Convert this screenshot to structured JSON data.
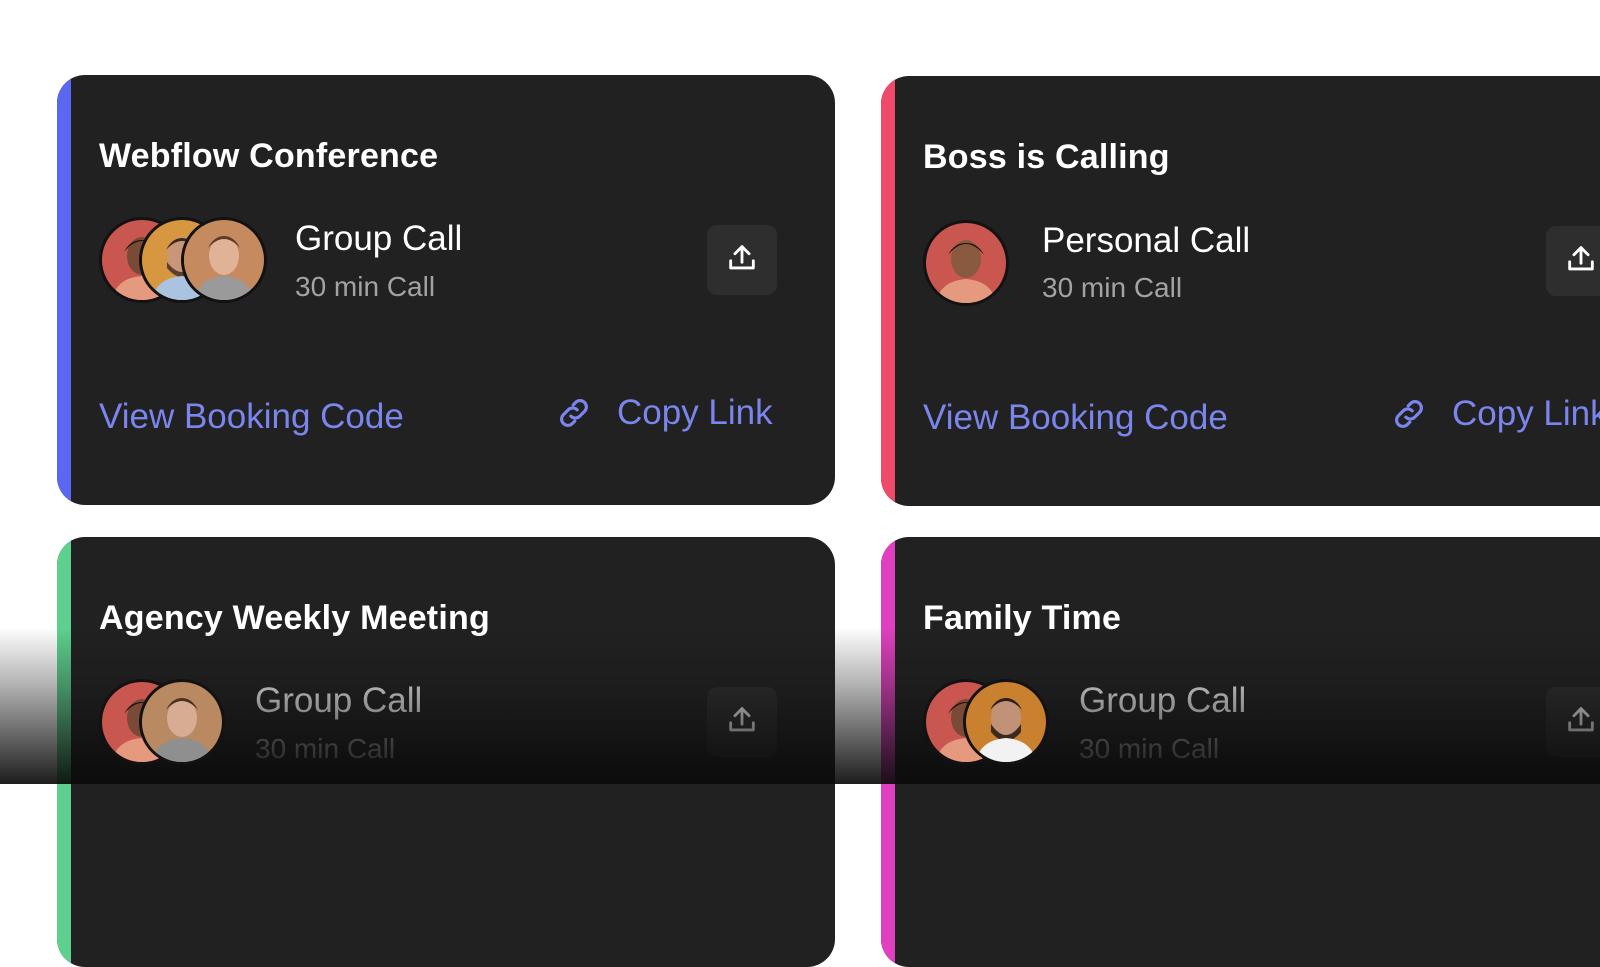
{
  "colors": {
    "card_bg": "#212121",
    "link": "#7b85ee",
    "accent_blue": "#5b67f0",
    "accent_red": "#f04a6a",
    "accent_green": "#5ed08e",
    "accent_pink": "#e040c0"
  },
  "cards": [
    {
      "title": "Webflow Conference",
      "call_type": "Group Call",
      "duration": "30 min Call",
      "view_label": "View Booking Code",
      "copy_label": "Copy Link",
      "avatar_count": 3
    },
    {
      "title": "Boss is Calling",
      "call_type": "Personal Call",
      "duration": "30 min Call",
      "view_label": "View Booking Code",
      "copy_label": "Copy Link",
      "avatar_count": 1
    },
    {
      "title": "Agency Weekly Meeting",
      "call_type": "Group Call",
      "duration": "30 min Call",
      "avatar_count": 2
    },
    {
      "title": "Family Time",
      "call_type": "Group Call",
      "duration": "30 min Call",
      "avatar_count": 2
    }
  ],
  "icons": {
    "share": "share-upload-icon",
    "link": "link-chain-icon"
  }
}
